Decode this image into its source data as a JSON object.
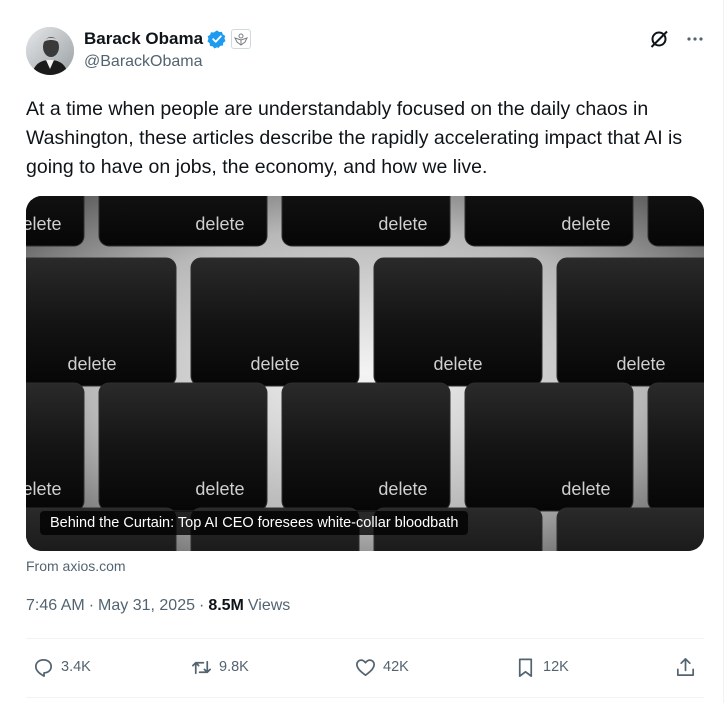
{
  "author": {
    "name": "Barack Obama",
    "handle": "@BarackObama"
  },
  "icons": {
    "verified": "verified-checkmark-icon",
    "government": "government-seal-icon",
    "grok": "grok-icon",
    "more": "more-options-icon"
  },
  "tweet": {
    "text": "At a time when people are understandably focused on the daily chaos in Washington, these articles describe the rapidly accelerating impact that AI is going to have on jobs, the economy, and how we live."
  },
  "card": {
    "key_label": "delete",
    "caption": "Behind the Curtain: Top AI CEO foresees white-collar bloodbath",
    "source": "From axios.com"
  },
  "meta": {
    "time": "7:46 AM",
    "separator": "·",
    "date": "May 31, 2025",
    "views_count": "8.5M",
    "views_label": "Views"
  },
  "actions": {
    "replies": "3.4K",
    "reposts": "9.8K",
    "likes": "42K",
    "bookmarks": "12K"
  },
  "colors": {
    "text": "#0f1419",
    "secondary": "#536471",
    "verified_blue": "#1d9bf0"
  }
}
